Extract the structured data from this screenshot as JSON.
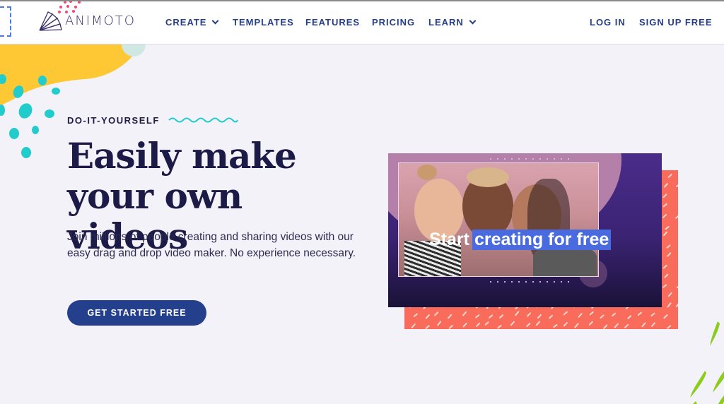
{
  "brand": {
    "name": "ANIMOTO"
  },
  "nav": {
    "items": [
      {
        "label": "CREATE",
        "has_dropdown": true
      },
      {
        "label": "TEMPLATES",
        "has_dropdown": false
      },
      {
        "label": "FEATURES",
        "has_dropdown": false
      },
      {
        "label": "PRICING",
        "has_dropdown": false
      },
      {
        "label": "LEARN",
        "has_dropdown": true
      }
    ],
    "login": "LOG IN",
    "signup": "SIGN UP FREE"
  },
  "hero": {
    "eyebrow": "DO-IT-YOURSELF",
    "title": "Easily make your own videos",
    "description": "Join millions of people creating and sharing videos with our easy drag and drop video maker. No experience necessary.",
    "cta": "GET STARTED FREE",
    "video_caption_plain": "Start",
    "video_caption_highlight": "creating for free"
  },
  "colors": {
    "nav_text": "#253e8a",
    "heading": "#1c1b47",
    "cta_bg": "#243f8c",
    "accent_yellow": "#fdc833",
    "accent_teal": "#22cbcc",
    "accent_coral": "#f96b5a",
    "accent_green": "#8ccc1a",
    "caption_highlight": "#4a6be0"
  }
}
